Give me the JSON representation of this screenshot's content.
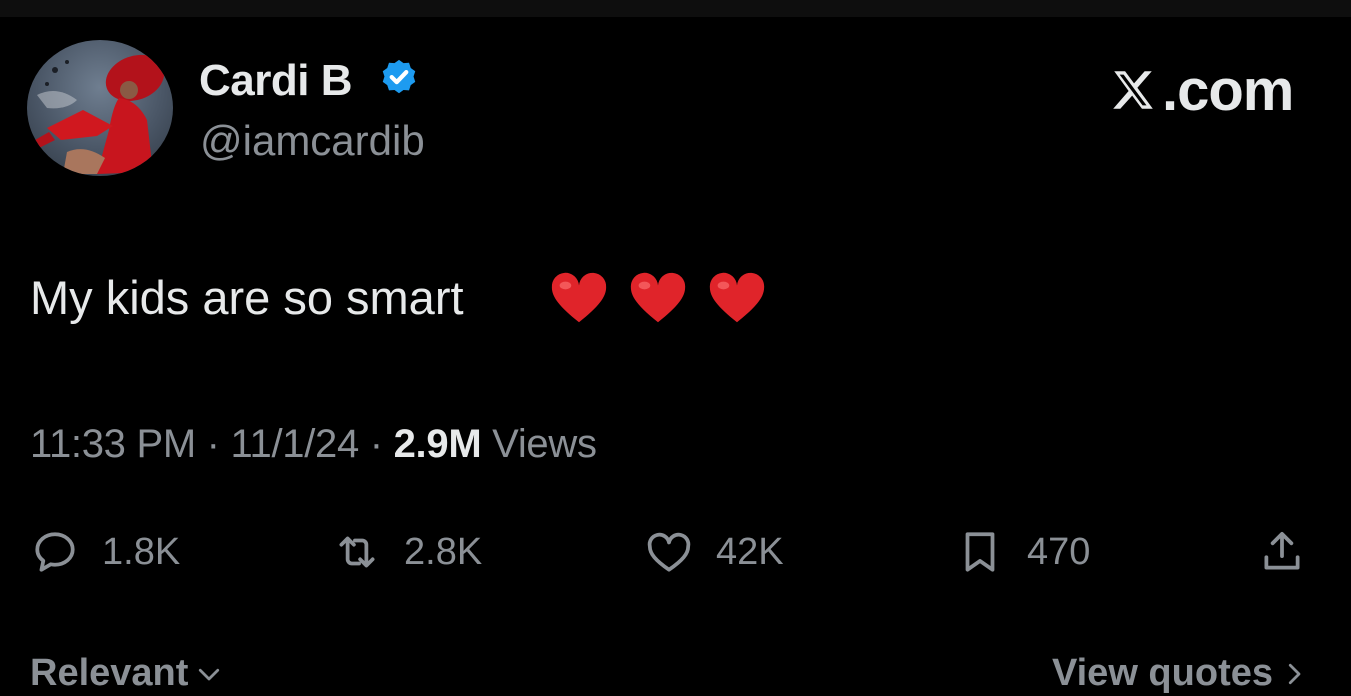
{
  "user": {
    "display_name": "Cardi B",
    "handle": "@iamcardib",
    "verified": true
  },
  "brand": {
    "suffix": ".com"
  },
  "tweet": {
    "text": "My kids are so smart",
    "emojis": [
      "red-heart",
      "red-heart",
      "red-heart"
    ],
    "time": "11:33 PM",
    "separator": "·",
    "date": "11/1/24",
    "views_count": "2.9M",
    "views_label": "Views"
  },
  "actions": {
    "replies": "1.8K",
    "reposts": "2.8K",
    "likes": "42K",
    "bookmarks": "470"
  },
  "footer": {
    "sort_label": "Relevant",
    "quotes_label": "View quotes"
  },
  "colors": {
    "background": "#000000",
    "primary_text": "#e7e9ea",
    "secondary_text": "#8b9096",
    "verified_blue": "#1d9bf0",
    "heart_red": "#e0242a"
  }
}
